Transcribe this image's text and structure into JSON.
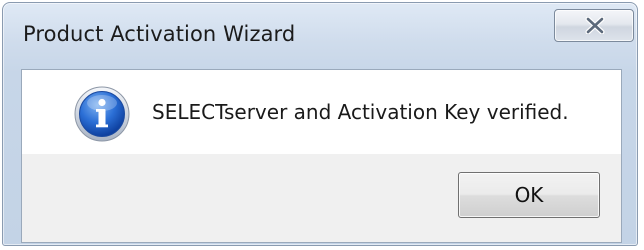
{
  "window": {
    "title": "Product Activation Wizard"
  },
  "dialog": {
    "message": "SELECTserver and Activation Key verified.",
    "icon": "info-icon",
    "ok_label": "OK"
  },
  "titlebar": {
    "close_icon": "close-icon"
  }
}
